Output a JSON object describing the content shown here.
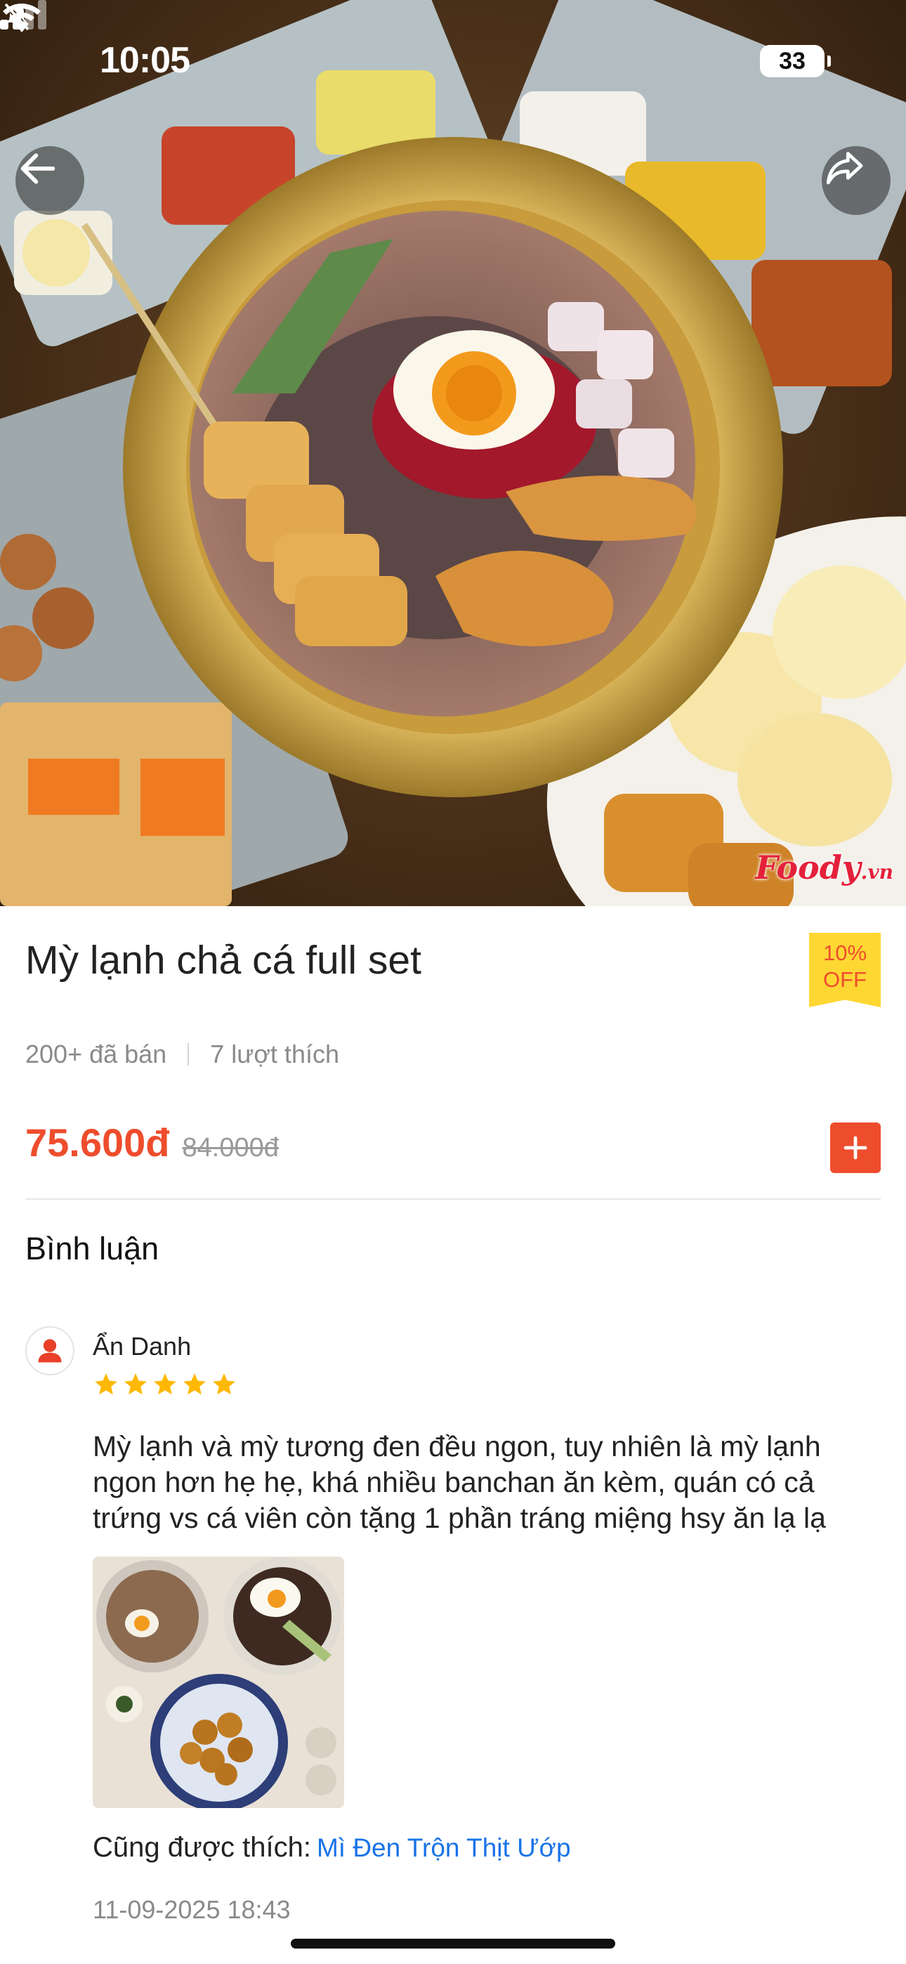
{
  "status_bar": {
    "time": "10:05",
    "battery": "33"
  },
  "hero": {
    "icons": [
      "back-arrow-icon",
      "share-icon",
      "bell-slash-icon",
      "signal-icon",
      "wifi-icon"
    ],
    "watermark": "Foody",
    "watermark_suffix": ".vn"
  },
  "product": {
    "title": "Mỳ lạnh chả cá full set",
    "discount_line1": "10%",
    "discount_line2": "OFF",
    "sold": "200+ đã bán",
    "likes": "7 lượt thích",
    "price": "75.600đ",
    "old_price": "84.000đ"
  },
  "comments": {
    "section_title": "Bình luận",
    "items": [
      {
        "name": "Ẩn Danh",
        "rating": 5,
        "text": "Mỳ lạnh và mỳ tương đen đều ngon, tuy nhiên là mỳ lạnh ngon hơn hẹ hẹ, khá nhiều banchan ăn kèm, quán có cả trứng vs cá viên còn tặng 1 phần tráng miệng hsy ăn lạ lạ",
        "also_like_label": "Cũng được thích:",
        "also_like_dish": "Mì Đen Trộn Thịt Ướp",
        "date": "11-09-2025 18:43"
      }
    ]
  },
  "colors": {
    "accent": "#ee4d2d",
    "badge": "#ffd733",
    "link": "#1a73e8",
    "star": "#ffb800"
  }
}
